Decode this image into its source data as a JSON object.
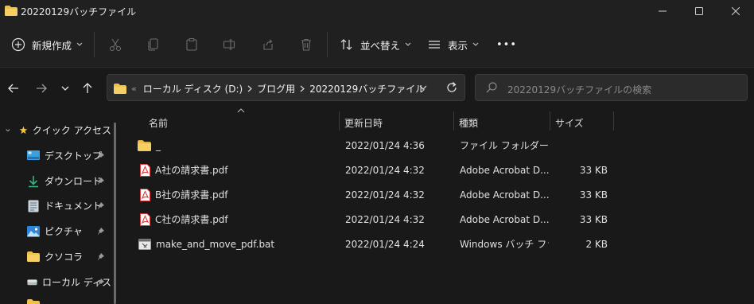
{
  "window": {
    "title": "20220129バッチファイル"
  },
  "toolbar": {
    "new_label": "新規作成",
    "sort_label": "並べ替え",
    "view_label": "表示",
    "more_label": "•••"
  },
  "address": {
    "crumbs": [
      "ローカル ディスク (D:)",
      "ブログ用",
      "20220129バッチファイル"
    ],
    "overflow_marker": "«"
  },
  "search": {
    "placeholder": "20220129バッチファイルの検索"
  },
  "nav": {
    "items": [
      {
        "label": "クイック アクセス",
        "icon": "star-icon"
      },
      {
        "label": "デスクトップ",
        "icon": "desktop-icon"
      },
      {
        "label": "ダウンロード",
        "icon": "download-icon"
      },
      {
        "label": "ドキュメント",
        "icon": "document-icon"
      },
      {
        "label": "ピクチャ",
        "icon": "pictures-icon"
      },
      {
        "label": "クソコラ",
        "icon": "folder-icon"
      },
      {
        "label": "ローカル ディス",
        "icon": "drive-icon"
      }
    ]
  },
  "columns": {
    "name": "名前",
    "modified": "更新日時",
    "type": "種類",
    "size": "サイズ"
  },
  "files": [
    {
      "name": "_",
      "modified": "2022/01/24 4:36",
      "type": "ファイル フォルダー",
      "size": "",
      "icon": "folder-icon"
    },
    {
      "name": "A社の請求書.pdf",
      "modified": "2022/01/24 4:32",
      "type": "Adobe Acrobat D...",
      "size": "33 KB",
      "icon": "pdf-icon"
    },
    {
      "name": "B社の請求書.pdf",
      "modified": "2022/01/24 4:32",
      "type": "Adobe Acrobat D...",
      "size": "33 KB",
      "icon": "pdf-icon"
    },
    {
      "name": "C社の請求書.pdf",
      "modified": "2022/01/24 4:32",
      "type": "Adobe Acrobat D...",
      "size": "33 KB",
      "icon": "pdf-icon"
    },
    {
      "name": "make_and_move_pdf.bat",
      "modified": "2022/01/24 4:24",
      "type": "Windows バッチ ファ...",
      "size": "2 KB",
      "icon": "batch-file-icon"
    }
  ],
  "colors": {
    "folder": "#f0c04a",
    "pdf": "#d93a3a",
    "accent_blue": "#3c8ddc",
    "background": "#191919",
    "chrome": "#202020"
  }
}
